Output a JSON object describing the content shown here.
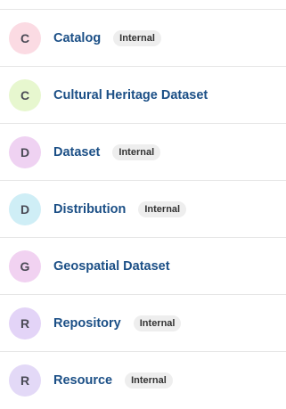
{
  "items": [
    {
      "initial": "C",
      "title": "Catalog",
      "badge": "Internal",
      "avatar_color": "#fbdbe3"
    },
    {
      "initial": "C",
      "title": "Cultural Heritage Dataset",
      "badge": "",
      "avatar_color": "#e7f7cf"
    },
    {
      "initial": "D",
      "title": "Dataset",
      "badge": "Internal",
      "avatar_color": "#efd2f2"
    },
    {
      "initial": "D",
      "title": "Distribution",
      "badge": "Internal",
      "avatar_color": "#cfeef6"
    },
    {
      "initial": "G",
      "title": "Geospatial Dataset",
      "badge": "",
      "avatar_color": "#f1d2f1"
    },
    {
      "initial": "R",
      "title": "Repository",
      "badge": "Internal",
      "avatar_color": "#e3d4f7"
    },
    {
      "initial": "R",
      "title": "Resource",
      "badge": "Internal",
      "avatar_color": "#e3d9f7"
    }
  ]
}
